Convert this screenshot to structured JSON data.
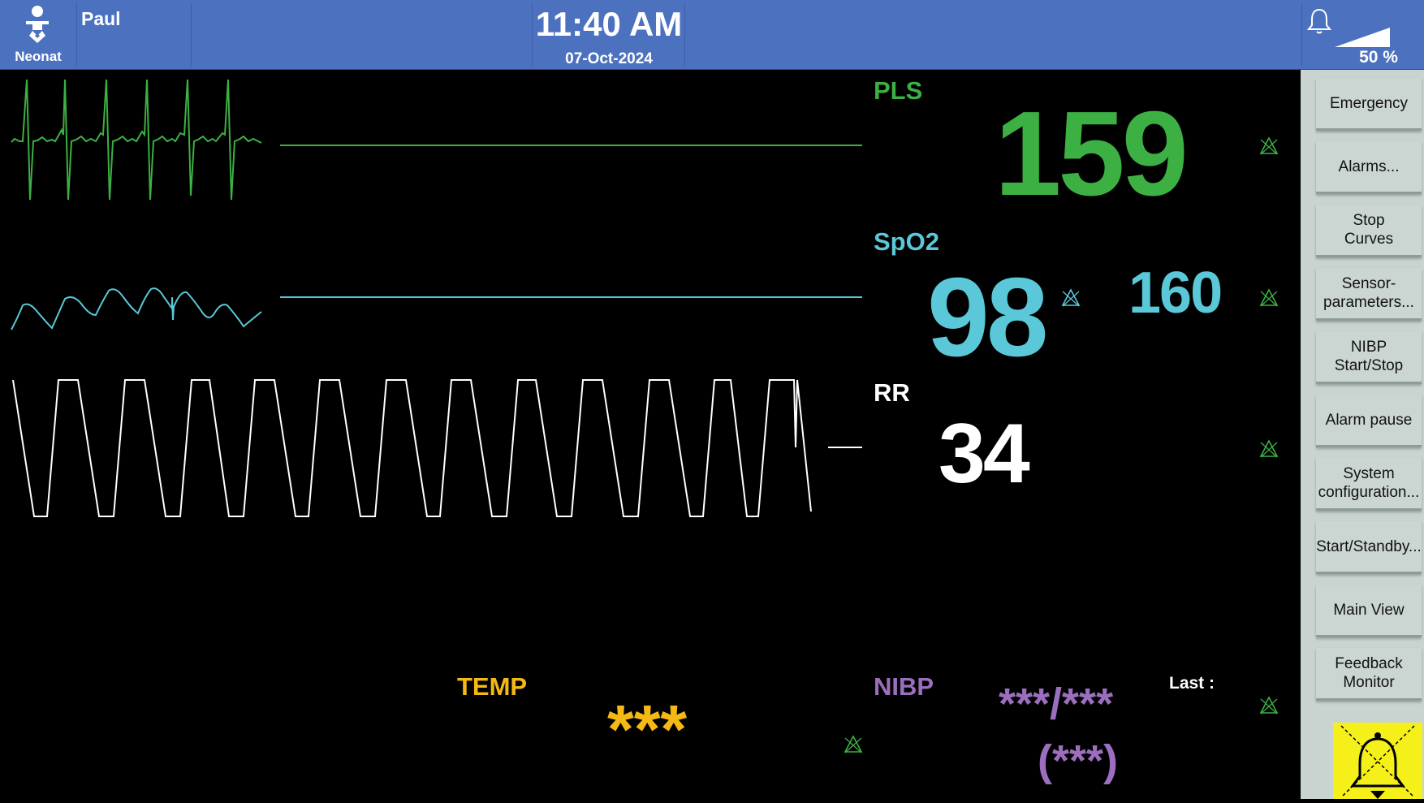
{
  "topbar": {
    "patient_type": "Neonat",
    "patient_name": "Paul",
    "time": "11:40 AM",
    "date": "07-Oct-2024",
    "battery_percent": "50 %",
    "bg_color": "#4c72bf"
  },
  "params": {
    "pls": {
      "label": "PLS",
      "value": "159",
      "color": "#3cb043"
    },
    "spo2": {
      "label": "SpO2",
      "value": "98",
      "secondary": "160",
      "color": "#5ac8d8"
    },
    "rr": {
      "label": "RR",
      "value": "34",
      "color": "#ffffff"
    },
    "temp": {
      "label": "TEMP",
      "value": "***",
      "color": "#f5b915"
    },
    "nibp": {
      "label": "NIBP",
      "value": "***/***",
      "mean": "(***)",
      "last_label": "Last :",
      "color": "#9b6fbd"
    }
  },
  "sidebar": {
    "buttons": [
      "Emergency",
      "Alarms...",
      "Stop\nCurves",
      "Sensor-\nparameters...",
      "NIBP\nStart/Stop",
      "Alarm pause",
      "System\nconfiguration...",
      "Start/Standby...",
      "Main View",
      "Feedback\nMonitor"
    ]
  },
  "icons": {
    "mode": "baby-icon",
    "alarm": "bell-icon",
    "muted": "alarm-muted-icon",
    "alarm_off": "alarm-off-icon"
  }
}
